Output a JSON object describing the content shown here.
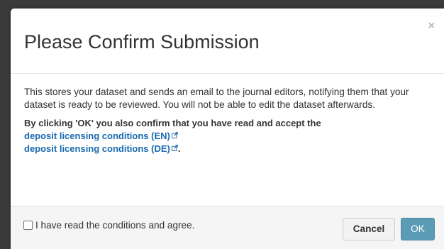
{
  "dialog": {
    "title": "Please Confirm Submission",
    "close_label": "×",
    "body_text": "This stores your dataset and sends an email to the journal editors, notifying them that your dataset is ready to be reviewed. You will not be able to edit the dataset afterwards.",
    "confirm_text": "By clicking 'OK' you also confirm that you have read and accept the",
    "link_en": "deposit licensing conditions (EN)",
    "link_de": "deposit licensing conditions (DE)",
    "link_de_suffix": ".",
    "agree_label": "I have read the conditions and agree.",
    "agree_checked": false,
    "cancel_label": "Cancel",
    "ok_label": "OK"
  },
  "colors": {
    "link": "#1a6ab0",
    "ok_button": "#5b9bb5",
    "footer_bg": "#f5f5f5"
  },
  "icons": {
    "external_link": "external-link-icon"
  }
}
